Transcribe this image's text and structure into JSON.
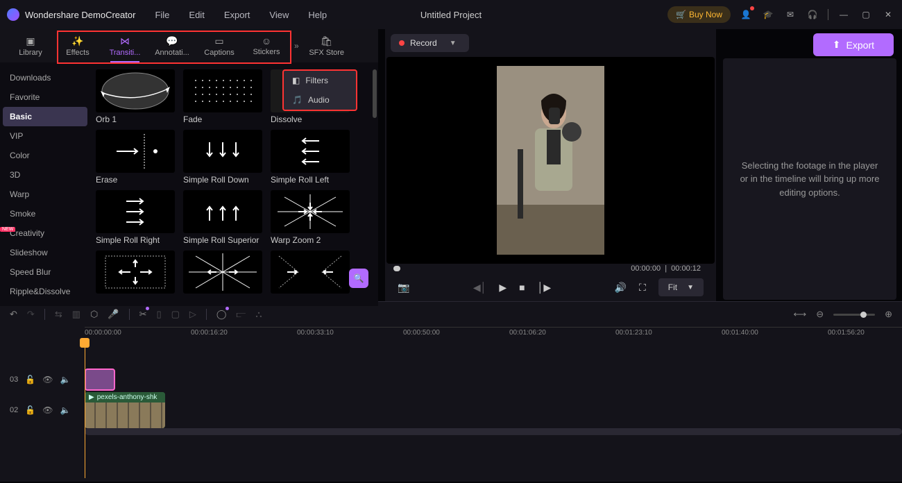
{
  "app": {
    "name": "Wondershare DemoCreator",
    "project": "Untitled Project"
  },
  "menu": [
    "File",
    "Edit",
    "Export",
    "View",
    "Help"
  ],
  "buy": "Buy Now",
  "export_btn": "Export",
  "record_btn": "Record",
  "tabs": [
    {
      "label": "Library"
    },
    {
      "label": "Effects"
    },
    {
      "label": "Transiti..."
    },
    {
      "label": "Annotati..."
    },
    {
      "label": "Captions"
    },
    {
      "label": "Stickers"
    },
    {
      "label": "SFX Store"
    }
  ],
  "sidebar": [
    {
      "label": "Downloads"
    },
    {
      "label": "Favorite"
    },
    {
      "label": "Basic",
      "active": true
    },
    {
      "label": "VIP"
    },
    {
      "label": "Color"
    },
    {
      "label": "3D"
    },
    {
      "label": "Warp"
    },
    {
      "label": "Smoke"
    },
    {
      "label": "Creativity",
      "new": true
    },
    {
      "label": "Slideshow"
    },
    {
      "label": "Speed Blur"
    },
    {
      "label": "Ripple&Dissolve"
    }
  ],
  "grid": [
    [
      {
        "label": "Orb 1"
      },
      {
        "label": "Fade"
      },
      {
        "label": "Dissolve"
      }
    ],
    [
      {
        "label": "Erase"
      },
      {
        "label": "Simple Roll Down"
      },
      {
        "label": "Simple Roll Left"
      }
    ],
    [
      {
        "label": "Simple Roll Right"
      },
      {
        "label": "Simple Roll Superior"
      },
      {
        "label": "Warp Zoom 2"
      }
    ],
    [
      {
        "label": ""
      },
      {
        "label": ""
      },
      {
        "label": ""
      }
    ]
  ],
  "dropdown": [
    {
      "label": "Filters",
      "icon": "filters-icon"
    },
    {
      "label": "Audio",
      "icon": "audio-icon"
    }
  ],
  "inspector_msg": "Selecting the footage in the player or in the timeline will bring up more editing options.",
  "time": {
    "current": "00:00:00",
    "total": "00:00:12"
  },
  "fit_label": "Fit",
  "ruler": [
    "00:00:00:00",
    "00:00:16:20",
    "00:00:33:10",
    "00:00:50:00",
    "00:01:06:20",
    "00:01:23:10",
    "00:01:40:00",
    "00:01:56:20"
  ],
  "tracks": {
    "t3": "03",
    "t2": "02"
  },
  "clip_name": "pexels-anthony-shk"
}
